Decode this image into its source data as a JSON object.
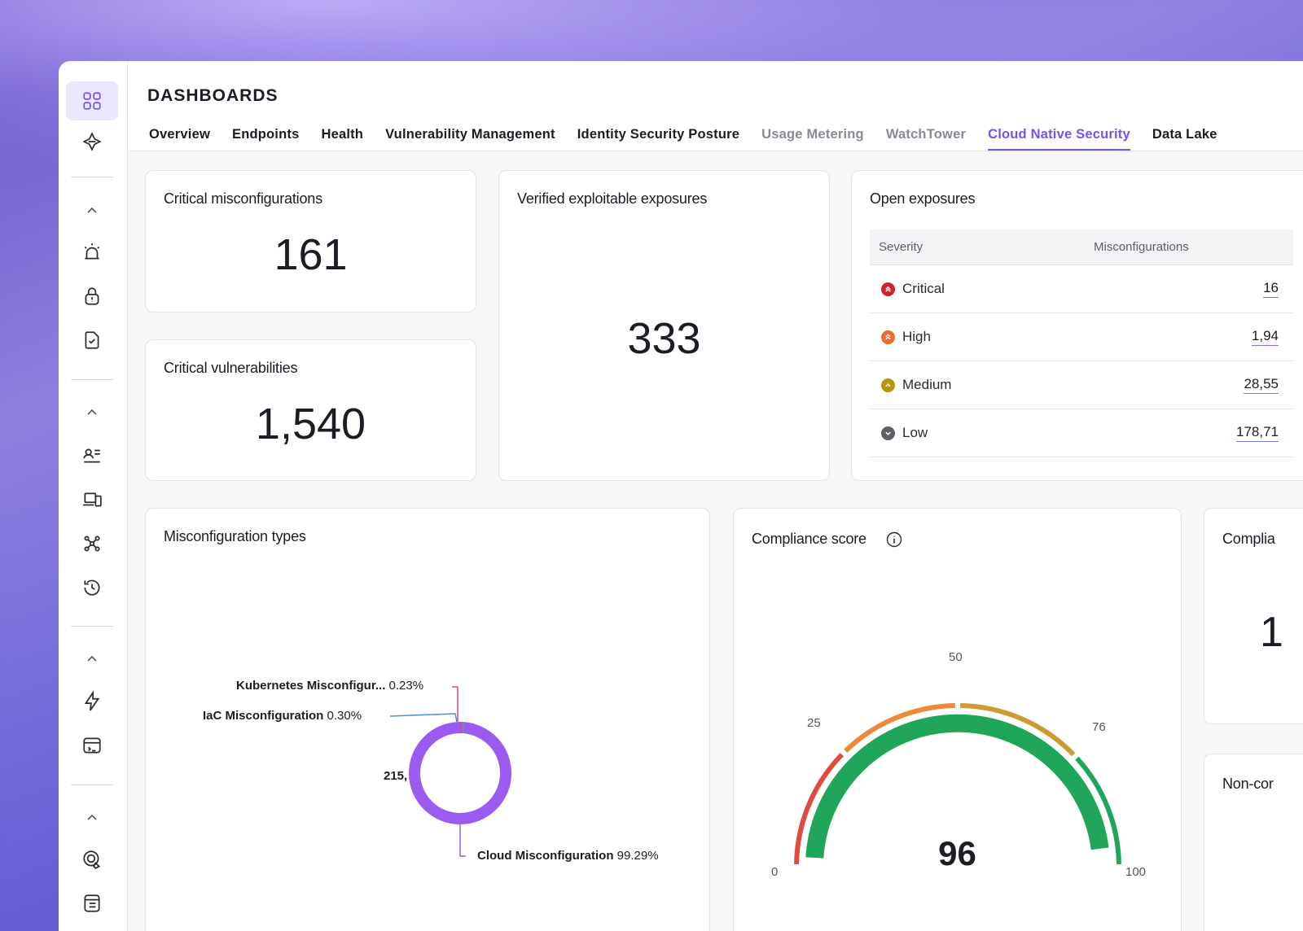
{
  "header": {
    "title": "DASHBOARDS"
  },
  "tabs": [
    {
      "label": "Overview"
    },
    {
      "label": "Endpoints"
    },
    {
      "label": "Health"
    },
    {
      "label": "Vulnerability Management"
    },
    {
      "label": "Identity Security Posture"
    },
    {
      "label": "Usage Metering"
    },
    {
      "label": "WatchTower"
    },
    {
      "label": "Cloud Native Security"
    },
    {
      "label": "Data Lake"
    }
  ],
  "active_tab": "Cloud Native Security",
  "cards": {
    "critical_misconfig": {
      "title": "Critical misconfigurations",
      "value": "161"
    },
    "critical_vulns": {
      "title": "Critical vulnerabilities",
      "value": "1,540"
    },
    "verified_exposures": {
      "title": "Verified exploitable exposures",
      "value": "333"
    },
    "open_exposures": {
      "title": "Open exposures",
      "columns": [
        "Severity",
        "Misconfigurations"
      ],
      "rows": [
        {
          "severity": "Critical",
          "value": "16",
          "color": "#d32030"
        },
        {
          "severity": "High",
          "value": "1,94",
          "color": "#ee6b2a"
        },
        {
          "severity": "Medium",
          "value": "28,55",
          "color": "#b8940c"
        },
        {
          "severity": "Low",
          "value": "178,71",
          "color": "#5f5f68"
        }
      ]
    },
    "misconfig_types": {
      "title": "Misconfiguration types",
      "center_label": "215,",
      "segments": [
        {
          "name": "Kubernetes Misconfigur...",
          "pct": "0.23%",
          "value": 0.23,
          "color": "#e0457a"
        },
        {
          "name": "IaC Misconfiguration",
          "pct": "0.30%",
          "value": 0.3,
          "color": "#4a8fe0"
        },
        {
          "name": "Cloud Misconfiguration",
          "pct": "99.29%",
          "value": 99.29,
          "color": "#9a5cf0"
        }
      ]
    },
    "compliance_score": {
      "title": "Compliance score",
      "score": "96",
      "score_value": 96,
      "ticks": [
        "0",
        "25",
        "50",
        "76",
        "100"
      ],
      "colors": {
        "red": "#e14b3a",
        "orange": "#ea8a3a",
        "amber": "#d09a33",
        "green": "#1fa65a"
      }
    },
    "compliance_partial": {
      "title": "Complia",
      "value": "1"
    },
    "noncompliant_partial": {
      "title": "Non-cor"
    }
  },
  "colors": {
    "accent": "#7a4ff0"
  }
}
